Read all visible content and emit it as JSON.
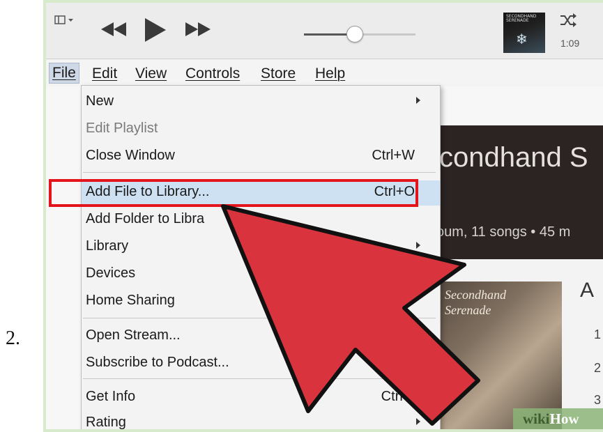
{
  "step_number": "2.",
  "toolbar": {
    "time": "1:09",
    "volume_level": 0.45,
    "album_thumb_text": "SECONDHAND SERENADE"
  },
  "menubar": {
    "items": [
      "File",
      "Edit",
      "View",
      "Controls",
      "Store",
      "Help"
    ]
  },
  "file_menu": {
    "items": [
      {
        "label": "New",
        "shortcut": "",
        "submenu": true,
        "disabled": false
      },
      {
        "label": "Edit Playlist",
        "shortcut": "",
        "submenu": false,
        "disabled": true
      },
      {
        "label": "Close Window",
        "shortcut": "Ctrl+W",
        "submenu": false,
        "disabled": false
      },
      {
        "label": "Add File to Library...",
        "shortcut": "Ctrl+O",
        "submenu": false,
        "disabled": false,
        "highlighted": true
      },
      {
        "label": "Add Folder to Libra",
        "shortcut": "",
        "submenu": false,
        "disabled": false
      },
      {
        "label": "Library",
        "shortcut": "",
        "submenu": true,
        "disabled": false
      },
      {
        "label": "Devices",
        "shortcut": "",
        "submenu": false,
        "disabled": false
      },
      {
        "label": "Home Sharing",
        "shortcut": "",
        "submenu": false,
        "disabled": false
      },
      {
        "label": "Open Stream...",
        "shortcut": "",
        "submenu": false,
        "disabled": false
      },
      {
        "label": "Subscribe to Podcast...",
        "shortcut": "",
        "submenu": false,
        "disabled": false
      },
      {
        "label": "Get Info",
        "shortcut": "Ctrl+I",
        "submenu": false,
        "disabled": false
      },
      {
        "label": "Rating",
        "shortcut": "",
        "submenu": true,
        "disabled": false
      }
    ]
  },
  "background_content": {
    "banner_title": "condhand S",
    "banner_small": "s",
    "banner_sub": "oum, 11 songs • 45 m",
    "section_letter": "A",
    "track_numbers": [
      "1",
      "2",
      "3"
    ],
    "album_art_text": "Secondhand Serenade"
  },
  "watermark": {
    "wiki": "wiki",
    "how": "How"
  },
  "colors": {
    "highlight": "#cde1f3",
    "annotation_box": "#e3141c",
    "arrow_fill": "#d9343d",
    "frame": "#d7eacb"
  }
}
